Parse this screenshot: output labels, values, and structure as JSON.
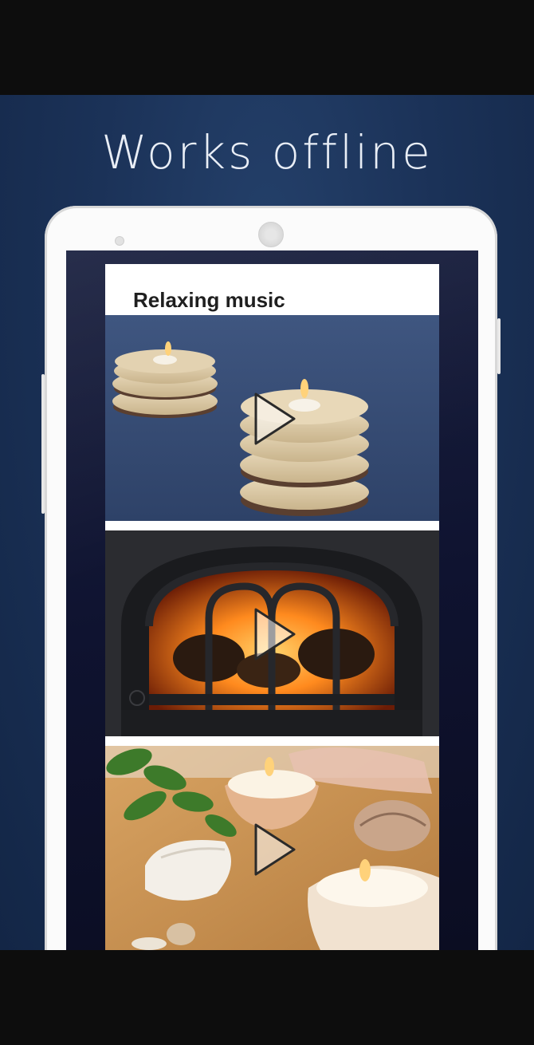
{
  "promo": {
    "headline": "Works offline"
  },
  "card": {
    "title": "Relaxing music"
  },
  "tracks": [
    {
      "scene": "cookie-candles",
      "play_icon": "play-icon"
    },
    {
      "scene": "fireplace",
      "play_icon": "play-icon"
    },
    {
      "scene": "seashell-candles",
      "play_icon": "play-icon"
    }
  ],
  "colors": {
    "background": "#1b3258",
    "headline": "#e9eef6",
    "phone_body": "#fbfbfb",
    "screen": "#0f1330",
    "card": "#ffffff",
    "title": "#1f1f1f"
  }
}
